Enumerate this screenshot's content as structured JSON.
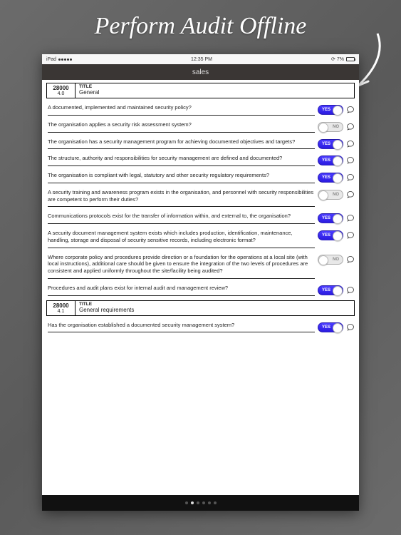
{
  "promo": {
    "title": "Perform Audit Offline"
  },
  "statusbar": {
    "carrier": "iPad",
    "time": "12:35 PM",
    "battery": "7%"
  },
  "navbar": {
    "title": "sales"
  },
  "sections": [
    {
      "code": "28000",
      "sub": "4.0",
      "title_label": "TITLE",
      "title_value": "General",
      "questions": [
        {
          "text": "A documented, implemented and maintained security policy?",
          "answer": "YES"
        },
        {
          "text": "The organisation applies a security risk assessment system?",
          "answer": "NO"
        },
        {
          "text": "The organisation has a security management program for achieving documented objectives and targets?",
          "answer": "YES"
        },
        {
          "text": "The structure, authority and responsibilities for security management are defined and documented?",
          "answer": "YES"
        },
        {
          "text": "The organisation is compliant with legal, statutory and other security regulatory requirements?",
          "answer": "YES"
        },
        {
          "text": "A security training and awareness program exists in the organisation, and personnel with security responsibilities are competent to perform their duties?",
          "answer": "NO"
        },
        {
          "text": "Communications protocols exist for the transfer of information within, and external to, the organisation?",
          "answer": "YES"
        },
        {
          "text": "A security document management system exists which includes production, identification, maintenance, handling, storage and disposal of security sensitive records, including electronic format?",
          "answer": "YES"
        },
        {
          "text": "Where corporate policy and procedures provide direction or a foundation for the operations at a local site (with local instructions), additional care should be given to ensure the integration of the two levels of procedures are consistent and applied uniformly throughout the site/facility being audited?",
          "answer": "NO"
        },
        {
          "text": "Procedures and audit plans exist for internal audit and management review?",
          "answer": "YES"
        }
      ]
    },
    {
      "code": "28000",
      "sub": "4.1",
      "title_label": "TITLE",
      "title_value": "General requirements",
      "questions": [
        {
          "text": "Has the organisation established a documented security management system?",
          "answer": "YES"
        }
      ]
    }
  ],
  "toggle_labels": {
    "yes": "YES",
    "no": "NO"
  },
  "pager": {
    "count": 6,
    "active": 1
  }
}
